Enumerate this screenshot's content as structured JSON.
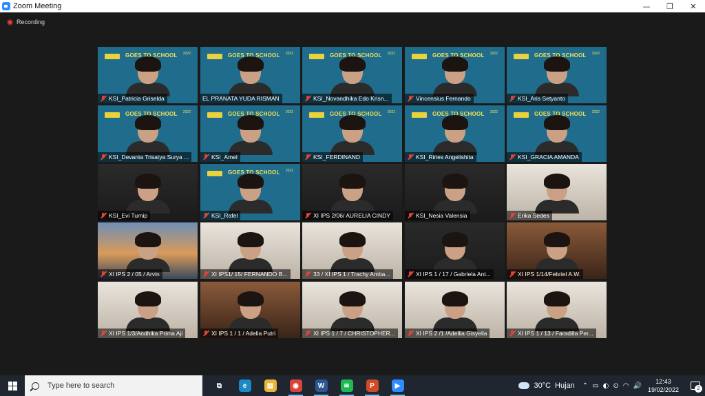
{
  "window": {
    "title": "Zoom Meeting",
    "minimize_glyph": "—",
    "restore_glyph": "❐",
    "close_glyph": "✕"
  },
  "meeting": {
    "recording_label": "Recording",
    "banner_headline": "GOES TO SCHOOL",
    "banner_year": "2022",
    "participants": [
      {
        "name": "KSI_Patricia Griselda",
        "muted": true,
        "bg": "banner",
        "active": false
      },
      {
        "name": "EL PRANATA YUDA RISMAN",
        "muted": false,
        "bg": "banner",
        "active": true
      },
      {
        "name": "KSI_Novandhika Edo Krisn...",
        "muted": true,
        "bg": "banner",
        "active": false
      },
      {
        "name": "Vincensius Fernando",
        "muted": true,
        "bg": "banner",
        "active": false
      },
      {
        "name": "KSI_Aris Setyanto",
        "muted": true,
        "bg": "banner",
        "active": false
      },
      {
        "name": "KSI_Devanta Trisatya Surya ...",
        "muted": true,
        "bg": "banner",
        "active": false
      },
      {
        "name": "KSI_Amel",
        "muted": true,
        "bg": "banner",
        "active": false
      },
      {
        "name": "KSI_FERDINAND",
        "muted": true,
        "bg": "banner",
        "active": false
      },
      {
        "name": "KSI_Riries Angelishita",
        "muted": true,
        "bg": "banner",
        "active": false
      },
      {
        "name": "KSI_GRACIA AMANDA",
        "muted": true,
        "bg": "banner",
        "active": false
      },
      {
        "name": "KSI_Evi Turnip",
        "muted": true,
        "bg": "room-dark",
        "active": false
      },
      {
        "name": "KSI_Rafel",
        "muted": true,
        "bg": "banner",
        "active": false
      },
      {
        "name": "XI IPS 2/06/ AURELIA CINDY",
        "muted": true,
        "bg": "room-dark",
        "active": false
      },
      {
        "name": "KSI_Nesia Valensia",
        "muted": true,
        "bg": "room-dark",
        "active": false
      },
      {
        "name": "Erika Sedes",
        "muted": true,
        "bg": "room-light",
        "active": false
      },
      {
        "name": "XI IPS 2 / 05 / Arvin",
        "muted": true,
        "bg": "sunset",
        "active": false
      },
      {
        "name": "XI IPS1/ 15/ FERNANDO B...",
        "muted": true,
        "bg": "room-light",
        "active": false
      },
      {
        "name": "33 / XI IPS 1 / Trachy Amba...",
        "muted": true,
        "bg": "room-light",
        "active": false
      },
      {
        "name": "XI IPS 1 / 17 / Gabriela Ant...",
        "muted": true,
        "bg": "room-dark",
        "active": false
      },
      {
        "name": "XI IPS 1/14/Febriel A.W.",
        "muted": true,
        "bg": "room-warm",
        "active": false
      },
      {
        "name": "XI IPS 1/3/Andhika Prima Aji",
        "muted": true,
        "bg": "room-light",
        "active": false
      },
      {
        "name": "XI IPS 1 / 1 / Adelia Putri",
        "muted": true,
        "bg": "room-warm",
        "active": false
      },
      {
        "name": "XI IPS 1 / 7 / CHRISTOPHER...",
        "muted": true,
        "bg": "room-light",
        "active": false
      },
      {
        "name": "XI IPS 2 /1 /Adellia Gisyella",
        "muted": true,
        "bg": "room-light",
        "active": false
      },
      {
        "name": "XI IPS 1 / 13 / Faradilla Per...",
        "muted": true,
        "bg": "room-light",
        "active": false
      }
    ]
  },
  "taskbar": {
    "search_placeholder": "Type here to search",
    "apps": [
      {
        "icon": "task-view-icon",
        "glyph": "⧉",
        "color": "#1f2630",
        "active": false
      },
      {
        "icon": "edge-icon",
        "glyph": "e",
        "color": "#1e88c7",
        "active": false
      },
      {
        "icon": "file-explorer-icon",
        "glyph": "▤",
        "color": "#e8b43a",
        "active": false
      },
      {
        "icon": "chrome-icon",
        "glyph": "◉",
        "color": "#d8443a",
        "active": true
      },
      {
        "icon": "word-icon",
        "glyph": "W",
        "color": "#2b5797",
        "active": true
      },
      {
        "icon": "spotify-icon",
        "glyph": "≋",
        "color": "#1db954",
        "active": true
      },
      {
        "icon": "powerpoint-icon",
        "glyph": "P",
        "color": "#d04a26",
        "active": true
      },
      {
        "icon": "zoom-icon",
        "glyph": "▶",
        "color": "#2d8cff",
        "active": true
      }
    ],
    "weather": {
      "temperature": "30°C",
      "condition": "Hujan"
    },
    "tray_glyphs": [
      "⌃",
      "▭",
      "◐",
      "⊙",
      "◠",
      "🔊"
    ],
    "time": "12:43",
    "date": "19/02/2022",
    "notification_count": "2"
  }
}
